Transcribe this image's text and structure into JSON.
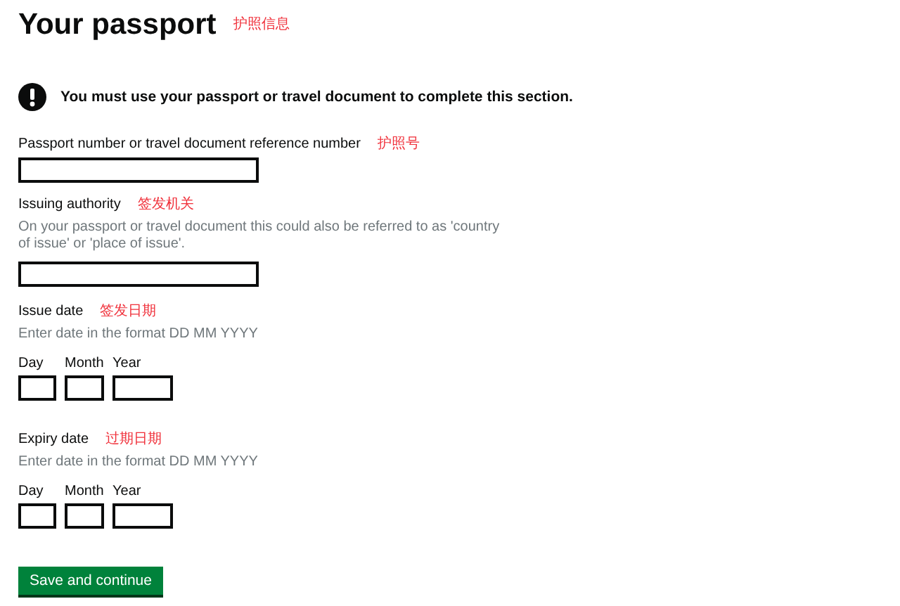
{
  "title": "Your passport",
  "title_note": "护照信息",
  "warning": "You must use your passport or travel document to complete this section.",
  "fields": [
    {
      "kind": "text",
      "label": "Passport number or travel document reference number",
      "note": "护照号"
    },
    {
      "kind": "text",
      "label": "Issuing authority",
      "note": "签发机关",
      "hint": "On your passport or travel document this could also be referred to as 'country of issue' or 'place of issue'."
    },
    {
      "kind": "date",
      "label": "Issue date",
      "note": "签发日期",
      "hint": "Enter date in the format DD MM YYYY",
      "parts": [
        {
          "kind": "day",
          "label": "Day"
        },
        {
          "kind": "month",
          "label": "Month"
        },
        {
          "kind": "year",
          "label": "Year"
        }
      ]
    },
    {
      "kind": "date",
      "label": "Expiry date",
      "note": "过期日期",
      "hint": "Enter date in the format DD MM YYYY",
      "parts": [
        {
          "kind": "day",
          "label": "Day"
        },
        {
          "kind": "month",
          "label": "Month"
        },
        {
          "kind": "year",
          "label": "Year"
        }
      ]
    }
  ],
  "button": "Save and continue"
}
